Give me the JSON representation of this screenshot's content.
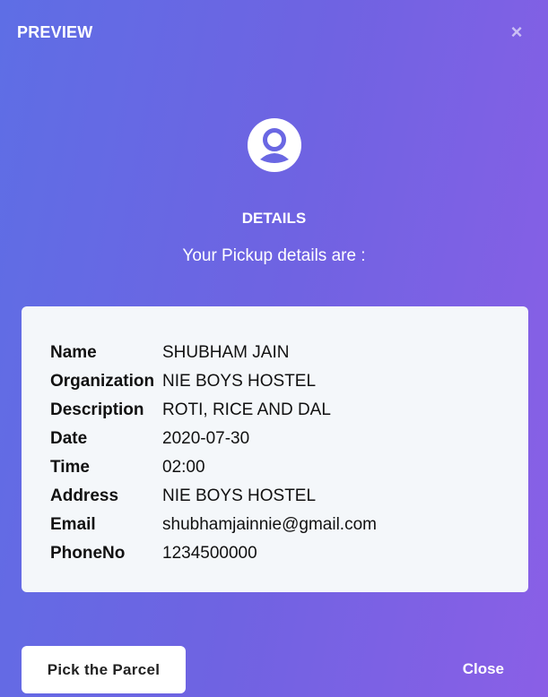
{
  "modal": {
    "title": "PREVIEW",
    "close_icon": "close-icon",
    "close_glyph": "×"
  },
  "header": {
    "avatar_icon": "user-avatar-icon",
    "heading": "DETAILS",
    "subtitle": "Your Pickup details are :"
  },
  "details": [
    {
      "label": "Name",
      "value": "SHUBHAM JAIN"
    },
    {
      "label": "Organization",
      "value": "NIE BOYS HOSTEL"
    },
    {
      "label": "Description",
      "value": "ROTI, RICE AND DAL"
    },
    {
      "label": "Date",
      "value": "2020-07-30"
    },
    {
      "label": "Time",
      "value": "02:00"
    },
    {
      "label": "Address",
      "value": "NIE BOYS HOSTEL"
    },
    {
      "label": "Email",
      "value": "shubhamjainnie@gmail.com"
    },
    {
      "label": "PhoneNo",
      "value": "1234500000"
    }
  ],
  "footer": {
    "pick_label": "Pick the Parcel",
    "close_label": "Close"
  },
  "colors": {
    "gradient_start": "#5e6ee5",
    "gradient_end": "#8a5fe6",
    "card_bg": "#f4f7fa",
    "text_dark": "#111111"
  }
}
